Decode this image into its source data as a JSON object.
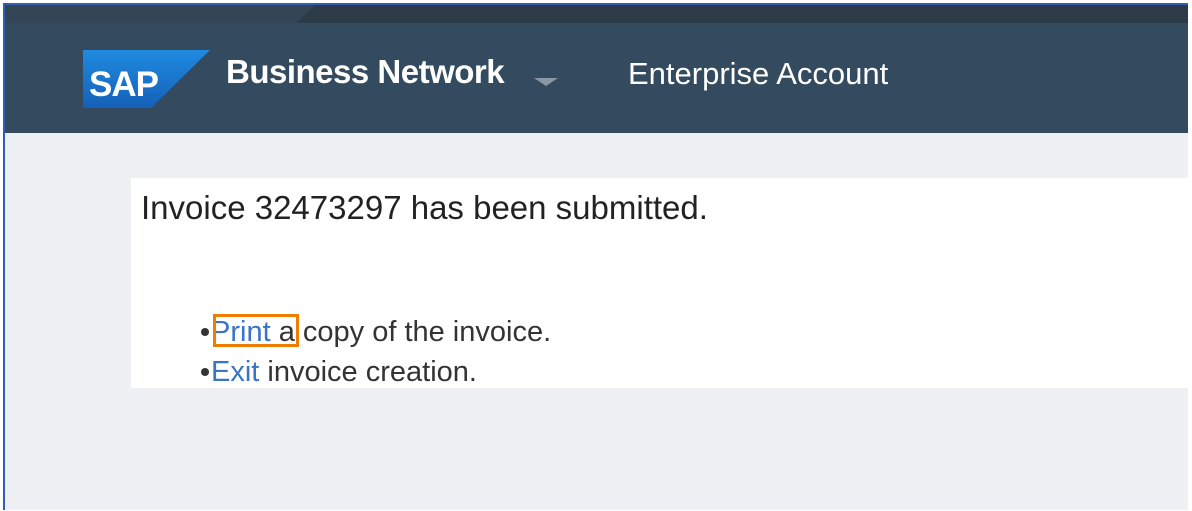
{
  "header": {
    "logo_text": "SAP",
    "brand": "Business Network",
    "account": "Enterprise Account"
  },
  "content": {
    "title": "Invoice 32473297 has been submitted.",
    "actions": [
      {
        "link": "Print",
        "text": " a copy of the invoice."
      },
      {
        "link": "Exit",
        "text": " invoice creation."
      }
    ]
  },
  "colors": {
    "header_bg": "#344a5f",
    "page_bg": "#eef0f3",
    "link": "#3a74c6",
    "highlight": "#f07d00",
    "logo_blue": "#1a75c8"
  },
  "icons": {
    "logo": "sap-logo-icon",
    "brand_dropdown": "chevron-down-icon"
  }
}
